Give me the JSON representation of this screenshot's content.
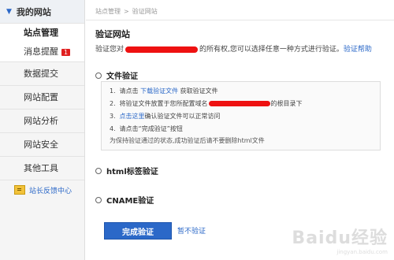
{
  "sidebar": {
    "header": "我的网站",
    "sub_items": [
      {
        "label": "站点管理"
      },
      {
        "label": "消息提醒",
        "badge": "1"
      }
    ],
    "items": [
      {
        "label": "数据提交"
      },
      {
        "label": "网站配置"
      },
      {
        "label": "网站分析"
      },
      {
        "label": "网站安全"
      },
      {
        "label": "其他工具"
      }
    ],
    "feedback": "站长反馈中心"
  },
  "breadcrumb": {
    "root": "站点管理",
    "separator": ">",
    "current": "验证网站"
  },
  "page": {
    "title": "验证网站",
    "desc_prefix": "验证您对",
    "desc_suffix": "的所有权,您可以选择任意一种方式进行验证。",
    "help_link": "验证帮助"
  },
  "methods": {
    "file": "文件验证",
    "html": "html标签验证",
    "cname": "CNAME验证"
  },
  "steps": {
    "s1_num": "1.",
    "s1_prefix": "请点击",
    "s1_link": "下载验证文件",
    "s1_suffix": "获取验证文件",
    "s2_num": "2.",
    "s2_prefix": "将验证文件放置于您所配置域名",
    "s2_suffix": "的根目录下",
    "s3_num": "3.",
    "s3_link": "点击这里",
    "s3_suffix": "确认验证文件可以正常访问",
    "s4_num": "4.",
    "s4_text": "请点击“完成验证”按钮",
    "note": "为保持验证通过的状态,成功验证后请不要删除html文件"
  },
  "actions": {
    "complete": "完成验证",
    "skip": "暂不验证"
  },
  "watermark": {
    "text": "Baidu经验",
    "sub": "jingyan.baidu.com"
  },
  "colors": {
    "accent": "#2b68c8",
    "redaction": "#e11111",
    "badge": "#e02020"
  }
}
